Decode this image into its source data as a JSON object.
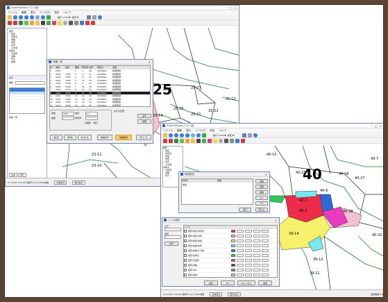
{
  "app": {
    "title1": "Super3ctools(テスト用)",
    "title2": "Super3ctools(テスト用)",
    "menu": [
      "ファイル",
      "編集",
      "表示",
      "ツール(T)",
      "設定",
      "ヘルプ"
    ],
    "toolbar_text1": "縮尺 1:500 ▼ ",
    "toolbar_text2": "検索 ▼",
    "toolbar_text3": "縮尺 1:500 ▼",
    "toolbar_text4": "検索 ▼"
  },
  "window1": {
    "tree_title": "表示",
    "tree_items": [
      "図形",
      "街区",
      "筆界点",
      "地番",
      "筆界",
      "境界",
      "その他",
      "基準点",
      "行政界",
      "道路",
      "河川",
      "建物"
    ],
    "panel_labels": {
      "type": "種別",
      "list": "区画一覧"
    },
    "tab_labels": [
      "全体",
      "部分"
    ],
    "status_buttons": [
      "全体表示",
      "部分表示",
      "地番表示",
      "座標表示"
    ],
    "status_text": "X=3.156 Y=8.125 図郭サイズ 1/500 座標",
    "status_right": "検索結果 0 件",
    "map_labels": [
      "25",
      "25-7",
      "25-27",
      "25-13",
      "25-25",
      "25-21",
      "25-14",
      "25-22",
      "23-11",
      "23-10"
    ]
  },
  "dialog1": {
    "title": "地番一覧",
    "table_header": [
      "No",
      "地番",
      "地目",
      "面積",
      "所有者",
      "住所",
      "登記日",
      "変更"
    ],
    "rows": [
      [
        "1",
        "2001",
        "",
        "1",
        "1",
        "16",
        "2000000",
        "新規登録"
      ],
      [
        "2",
        "2001",
        "7556",
        "3",
        "5",
        "41",
        "2000000",
        "新規登録"
      ],
      [
        "3",
        "2001",
        "7556",
        "4",
        "11",
        "27",
        "2000000",
        "新規登録"
      ],
      [
        "4",
        "2001",
        "7556",
        "5",
        "11",
        "39",
        "5200000",
        "新規登録"
      ],
      [
        "5",
        "2001",
        "7556",
        "6",
        "9",
        "54",
        "5200000",
        "新規登録"
      ],
      [
        "6",
        "2001",
        "7556",
        "7",
        "11",
        "56",
        "5200000",
        "新規登録"
      ],
      [
        "7",
        "2001",
        "7556",
        "8",
        "11",
        "42",
        "5200000",
        "新規登録"
      ],
      [
        "8",
        "2001",
        "7556",
        "9",
        "11",
        "38",
        "5200000",
        "新規登録"
      ],
      [
        "9",
        "2001",
        "7556",
        "10",
        "25",
        "44",
        "5200000",
        "新規登録"
      ],
      [
        "10",
        "2001",
        "7556",
        "11",
        "25",
        "44",
        "5200000",
        "新規登録"
      ],
      [
        "11",
        "2001",
        "7556",
        "12",
        "25",
        "31",
        "5200000",
        "新規登録"
      ],
      [
        "12",
        "2001",
        "7556",
        "13",
        "25",
        "39",
        "5200000",
        "新規登録"
      ]
    ],
    "form_labels": [
      "地番",
      "地目",
      "面積",
      "所有者"
    ],
    "form_values": [
      "7556",
      "23",
      "",
      ""
    ],
    "radio_labels": [
      "全選択",
      "部分"
    ],
    "note": "表示を変更",
    "side_buttons": [
      "表示",
      "選択",
      "解除",
      "全表示"
    ],
    "bottom_buttons": [
      "検 索",
      "解 除",
      "全 表 示",
      "地番表示",
      "地番検索",
      "閉 じ る"
    ]
  },
  "window2": {
    "tree_items": [
      "図形",
      "街区",
      "筆界点",
      "地番",
      "筆界",
      "境界",
      "その他",
      "基準点",
      "行政界",
      "道路",
      "河川"
    ],
    "status_text": "X=3.156 Y=8.125 図郭サイズ 1/500 座標",
    "status_right": "検索結果 0 件",
    "status_buttons": [
      "全体表示",
      "部分表示",
      "地番表示",
      "座標表示"
    ],
    "map_labels": [
      "40",
      "40-2",
      "40-6",
      "40-3",
      "40-38",
      "40-25",
      "39-14",
      "40-27",
      "39-12",
      "40-31",
      "40-26",
      "39-11",
      "40-10",
      "40-7"
    ]
  },
  "dialog2": {
    "title": "検索設定",
    "col_headers": [
      "条件名",
      "範囲"
    ],
    "value": "地番",
    "buttons": [
      "追加",
      "変更",
      "削除",
      "上へ",
      "下へ",
      "実行",
      "閉じる"
    ]
  },
  "dialog3": {
    "title": "レイヤ設定",
    "labels": [
      "表示",
      "選択",
      "レイヤ"
    ],
    "buttons": [
      "表示",
      "設定",
      "OK",
      "キャンセル",
      "適用"
    ],
    "layer_rows": [
      "図形/街区/筆界点",
      "図形/街区/筆界",
      "図形/街区/地番",
      "図形/地番/境界",
      "図形/地番/その他",
      "図形/基準点",
      "図形/行政界",
      "図形/道路",
      "図形/河川",
      "図形/建物"
    ]
  },
  "colors": {
    "highlight_row": "#1f1f1f",
    "pink_parcel": "#f3c1cf",
    "red_parcel": "#ef2b4a",
    "yellow_parcel": "#f7f06a",
    "cyan_parcel": "#78e6ec",
    "blue_parcel": "#2c6ad7",
    "green_parcel": "#30c55a",
    "magenta_parcel": "#e83bbf"
  }
}
